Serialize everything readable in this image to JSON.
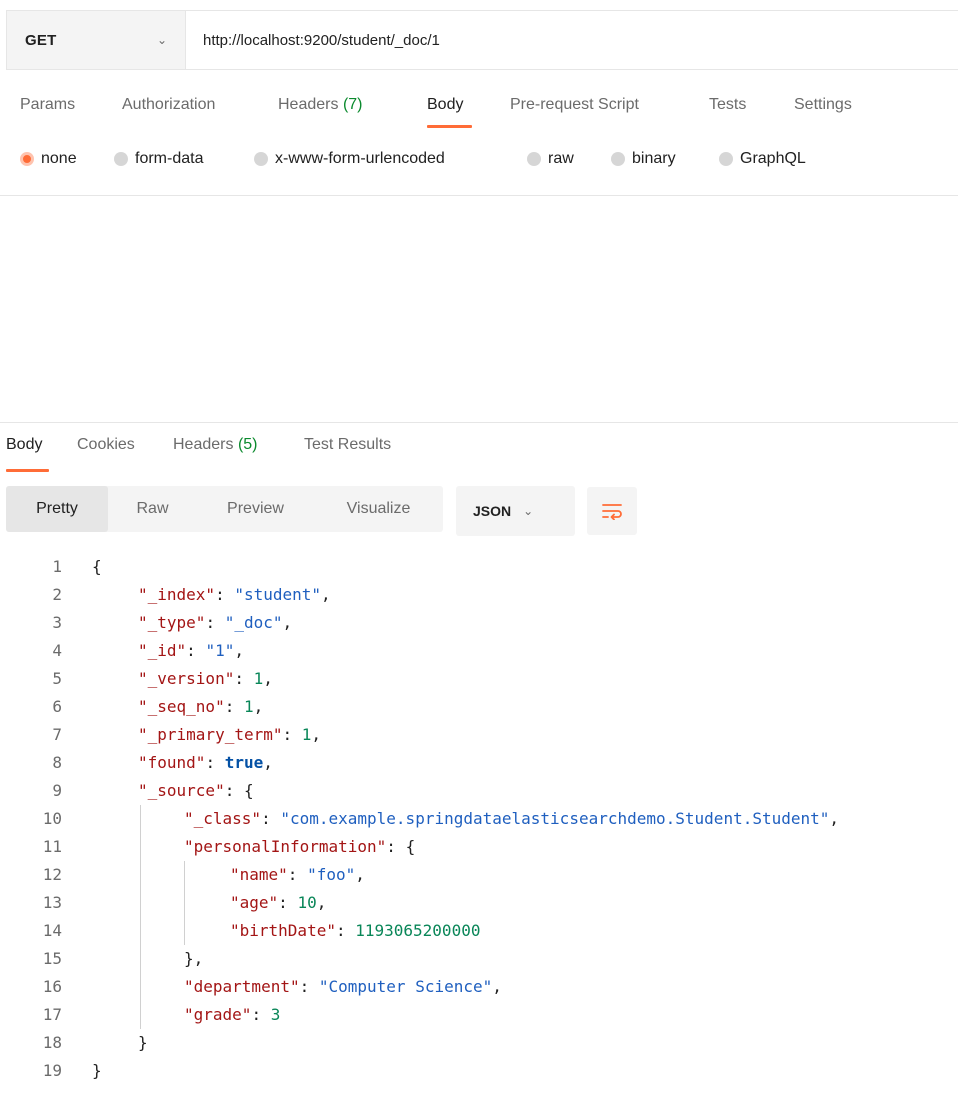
{
  "request": {
    "method": "GET",
    "url": "http://localhost:9200/student/_doc/1"
  },
  "request_tabs": [
    {
      "label": "Params",
      "count": ""
    },
    {
      "label": "Authorization",
      "count": ""
    },
    {
      "label": "Headers",
      "count": "(7)"
    },
    {
      "label": "Body",
      "count": "",
      "active": true
    },
    {
      "label": "Pre-request Script",
      "count": ""
    },
    {
      "label": "Tests",
      "count": ""
    },
    {
      "label": "Settings",
      "count": ""
    }
  ],
  "body_types": [
    {
      "label": "none",
      "selected": true
    },
    {
      "label": "form-data"
    },
    {
      "label": "x-www-form-urlencoded"
    },
    {
      "label": "raw"
    },
    {
      "label": "binary"
    },
    {
      "label": "GraphQL"
    }
  ],
  "response_tabs": [
    {
      "label": "Body",
      "count": "",
      "active": true
    },
    {
      "label": "Cookies",
      "count": ""
    },
    {
      "label": "Headers",
      "count": "(5)"
    },
    {
      "label": "Test Results",
      "count": ""
    }
  ],
  "view_modes": [
    "Pretty",
    "Raw",
    "Preview",
    "Visualize"
  ],
  "active_view": "Pretty",
  "format": "JSON",
  "colors": {
    "accent": "#ff6c37",
    "count_green": "#0b8a2e",
    "json_key": "#a31515",
    "json_string": "#1f5fbf",
    "json_number": "#098658",
    "json_bool": "#0451a5"
  },
  "code_lines": [
    {
      "n": "1",
      "indent": 0,
      "tokens": [
        [
          "p",
          "{"
        ]
      ]
    },
    {
      "n": "2",
      "indent": 1,
      "tokens": [
        [
          "k",
          "\"_index\""
        ],
        [
          "p",
          ": "
        ],
        [
          "s",
          "\"student\""
        ],
        [
          "p",
          ","
        ]
      ]
    },
    {
      "n": "3",
      "indent": 1,
      "tokens": [
        [
          "k",
          "\"_type\""
        ],
        [
          "p",
          ": "
        ],
        [
          "s",
          "\"_doc\""
        ],
        [
          "p",
          ","
        ]
      ]
    },
    {
      "n": "4",
      "indent": 1,
      "tokens": [
        [
          "k",
          "\"_id\""
        ],
        [
          "p",
          ": "
        ],
        [
          "s",
          "\"1\""
        ],
        [
          "p",
          ","
        ]
      ]
    },
    {
      "n": "5",
      "indent": 1,
      "tokens": [
        [
          "k",
          "\"_version\""
        ],
        [
          "p",
          ": "
        ],
        [
          "n",
          "1"
        ],
        [
          "p",
          ","
        ]
      ]
    },
    {
      "n": "6",
      "indent": 1,
      "tokens": [
        [
          "k",
          "\"_seq_no\""
        ],
        [
          "p",
          ": "
        ],
        [
          "n",
          "1"
        ],
        [
          "p",
          ","
        ]
      ]
    },
    {
      "n": "7",
      "indent": 1,
      "tokens": [
        [
          "k",
          "\"_primary_term\""
        ],
        [
          "p",
          ": "
        ],
        [
          "n",
          "1"
        ],
        [
          "p",
          ","
        ]
      ]
    },
    {
      "n": "8",
      "indent": 1,
      "tokens": [
        [
          "k",
          "\"found\""
        ],
        [
          "p",
          ": "
        ],
        [
          "b",
          "true"
        ],
        [
          "p",
          ","
        ]
      ]
    },
    {
      "n": "9",
      "indent": 1,
      "tokens": [
        [
          "k",
          "\"_source\""
        ],
        [
          "p",
          ": {"
        ]
      ]
    },
    {
      "n": "10",
      "indent": 2,
      "tokens": [
        [
          "k",
          "\"_class\""
        ],
        [
          "p",
          ": "
        ],
        [
          "s",
          "\"com.example.springdataelasticsearchdemo.Student.Student\""
        ],
        [
          "p",
          ","
        ]
      ]
    },
    {
      "n": "11",
      "indent": 2,
      "tokens": [
        [
          "k",
          "\"personalInformation\""
        ],
        [
          "p",
          ": {"
        ]
      ]
    },
    {
      "n": "12",
      "indent": 3,
      "tokens": [
        [
          "k",
          "\"name\""
        ],
        [
          "p",
          ": "
        ],
        [
          "s",
          "\"foo\""
        ],
        [
          "p",
          ","
        ]
      ]
    },
    {
      "n": "13",
      "indent": 3,
      "tokens": [
        [
          "k",
          "\"age\""
        ],
        [
          "p",
          ": "
        ],
        [
          "n",
          "10"
        ],
        [
          "p",
          ","
        ]
      ]
    },
    {
      "n": "14",
      "indent": 3,
      "tokens": [
        [
          "k",
          "\"birthDate\""
        ],
        [
          "p",
          ": "
        ],
        [
          "n",
          "1193065200000"
        ]
      ]
    },
    {
      "n": "15",
      "indent": 2,
      "tokens": [
        [
          "p",
          "},"
        ]
      ]
    },
    {
      "n": "16",
      "indent": 2,
      "tokens": [
        [
          "k",
          "\"department\""
        ],
        [
          "p",
          ": "
        ],
        [
          "s",
          "\"Computer Science\""
        ],
        [
          "p",
          ","
        ]
      ]
    },
    {
      "n": "17",
      "indent": 2,
      "tokens": [
        [
          "k",
          "\"grade\""
        ],
        [
          "p",
          ": "
        ],
        [
          "n",
          "3"
        ]
      ]
    },
    {
      "n": "18",
      "indent": 1,
      "tokens": [
        [
          "p",
          "}"
        ]
      ]
    },
    {
      "n": "19",
      "indent": 0,
      "tokens": [
        [
          "p",
          "}"
        ]
      ]
    }
  ]
}
